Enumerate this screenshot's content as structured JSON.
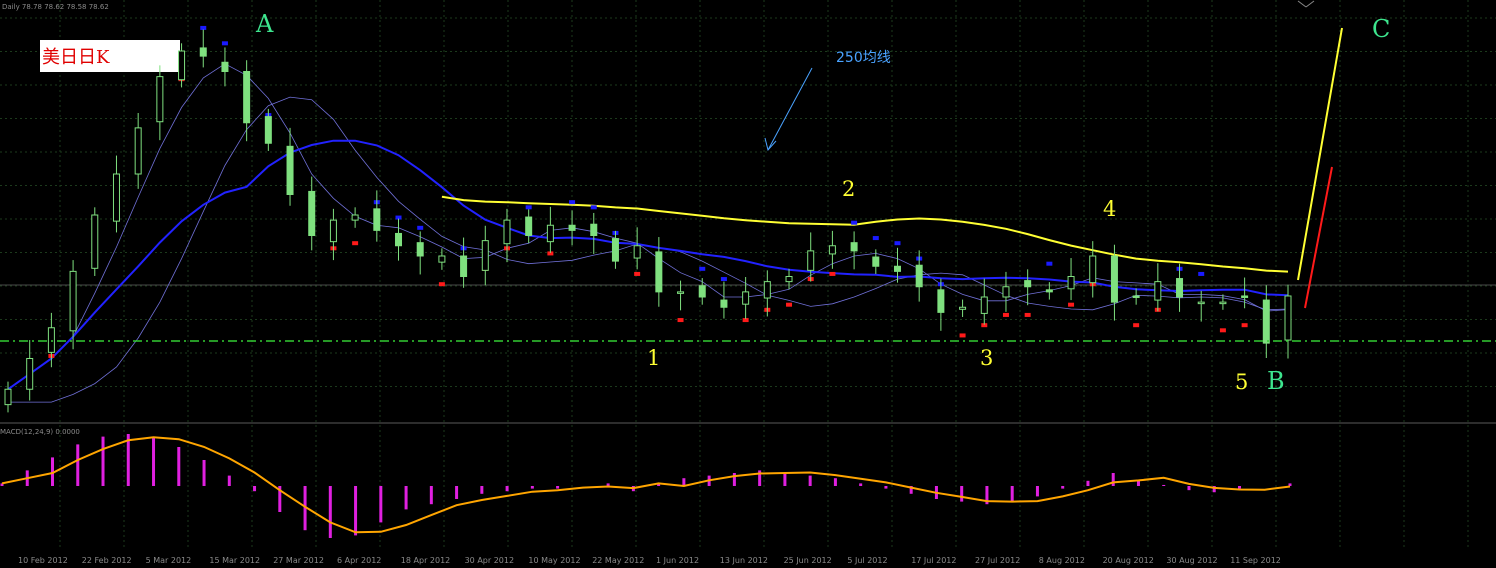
{
  "symbol_info": "Daily  78.78 78.62 78.58 78.62",
  "macd_label": "MACD(12,24,9) 0.0000",
  "chart_title": "美日日K",
  "ma_annotation": "250均线",
  "wave_labels": {
    "A": "A",
    "B": "B",
    "C": "C",
    "w1": "1",
    "w2": "2",
    "w3": "3",
    "w4": "4",
    "w5": "5"
  },
  "colors": {
    "background": "#000000",
    "grid": "#1c3a1c",
    "candle": "#7fe07f",
    "ma250": "#ffff33",
    "ma_blue": "#2222ff",
    "ma_thin": "#7070d8",
    "sar_red": "#ff1a1a",
    "sar_blue": "#1a1aff",
    "macd_hist": "#e020e0",
    "macd_signal": "#ffa500",
    "support": "#33cc33"
  },
  "chart_data": {
    "type": "candlestick",
    "price_chart": {
      "x_labels": [
        "10 Feb 2012",
        "22 Feb 2012",
        "5 Mar 2012",
        "15 Mar 2012",
        "27 Mar 2012",
        "6 Apr 2012",
        "18 Apr 2012",
        "30 Apr 2012",
        "10 May 2012",
        "22 May 2012",
        "1 Jun 2012",
        "13 Jun 2012",
        "25 Jun 2012",
        "5 Jul 2012",
        "17 Jul 2012",
        "27 Jul 2012",
        "8 Aug 2012",
        "20 Aug 2012",
        "30 Aug 2012",
        "11 Sep 2012"
      ],
      "close_approx": [
        76.8,
        77.4,
        78.0,
        79.1,
        80.2,
        81.0,
        81.9,
        82.9,
        83.4,
        83.3,
        83.0,
        82.0,
        81.6,
        80.6,
        79.8,
        80.1,
        80.2,
        79.9,
        79.6,
        79.4,
        79.4,
        79.0,
        79.7,
        80.1,
        79.8,
        80.0,
        79.9,
        79.8,
        79.3,
        79.6,
        78.7,
        78.7,
        78.6,
        78.4,
        78.7,
        78.9,
        79.0,
        79.5,
        79.6,
        79.5,
        79.2,
        79.1,
        78.8,
        78.3,
        78.4,
        78.6,
        78.8,
        78.8,
        78.7,
        79.0,
        79.4,
        78.5,
        78.6,
        78.9,
        78.6,
        78.5,
        78.5,
        78.6,
        77.7,
        78.62
      ],
      "support_level": 77.9
    },
    "macd": {
      "label": "MACD(12,24,9)",
      "histogram_approx": [
        0.05,
        0.3,
        0.55,
        0.8,
        0.95,
        1.0,
        0.92,
        0.75,
        0.5,
        0.2,
        -0.1,
        -0.5,
        -0.85,
        -1.0,
        -0.95,
        -0.7,
        -0.45,
        -0.35,
        -0.25,
        -0.15,
        -0.1,
        -0.05,
        -0.05,
        0.0,
        0.05,
        -0.1,
        0.05,
        0.15,
        0.2,
        0.25,
        0.3,
        0.25,
        0.2,
        0.15,
        0.05,
        -0.05,
        -0.15,
        -0.25,
        -0.3,
        -0.35,
        -0.3,
        -0.2,
        -0.05,
        0.1,
        0.25,
        0.12,
        0.02,
        -0.08,
        -0.12,
        -0.05,
        0.0,
        0.05
      ]
    }
  }
}
